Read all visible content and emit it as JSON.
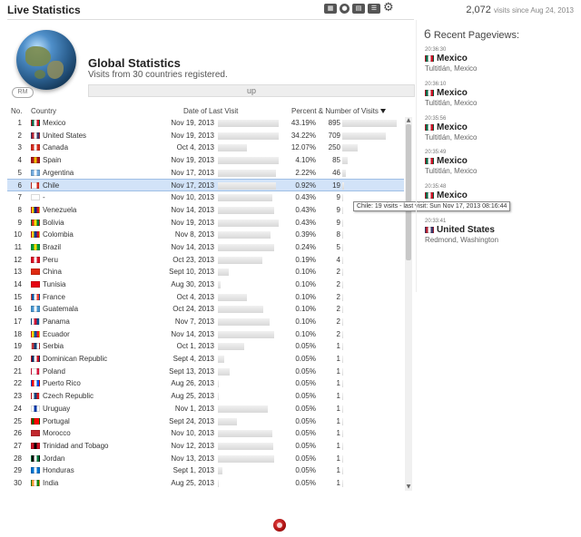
{
  "app": {
    "title": "Live Statistics"
  },
  "toolbar": {
    "icons": [
      "map-icon",
      "globe-icon",
      "stats-icon",
      "list-icon",
      "settings-icon"
    ]
  },
  "visits": {
    "count": "2,072",
    "since": "visits since Aug 24, 2013"
  },
  "global": {
    "heading": "Global Statistics",
    "subtitle": "Visits from 30 countries registered.",
    "up_label": "up",
    "rm_label": "RM"
  },
  "table": {
    "headers": {
      "no": "No.",
      "country": "Country",
      "date": "Date of Last Visit",
      "pct": "Percent & Number of Visits"
    },
    "selected_row": 6,
    "rows": [
      {
        "no": "1",
        "country": "Mexico",
        "date": "Nov 19, 2013",
        "date_fill": 0.95,
        "pct": "43.19%",
        "count": "895",
        "count_fill": 1.0,
        "flag": [
          "#006847",
          "#fff",
          "#ce1126"
        ]
      },
      {
        "no": "2",
        "country": "United States",
        "date": "Nov 19, 2013",
        "date_fill": 0.95,
        "pct": "34.22%",
        "count": "709",
        "count_fill": 0.8,
        "flag": [
          "#b22234",
          "#fff",
          "#3c3b6e"
        ]
      },
      {
        "no": "3",
        "country": "Canada",
        "date": "Oct 4, 2013",
        "date_fill": 0.45,
        "pct": "12.07%",
        "count": "250",
        "count_fill": 0.28,
        "flag": [
          "#d52b1e",
          "#fff",
          "#d52b1e"
        ]
      },
      {
        "no": "4",
        "country": "Spain",
        "date": "Nov 19, 2013",
        "date_fill": 0.95,
        "pct": "4.10%",
        "count": "85",
        "count_fill": 0.1,
        "flag": [
          "#aa151b",
          "#f1bf00",
          "#aa151b"
        ]
      },
      {
        "no": "5",
        "country": "Argentina",
        "date": "Nov 17, 2013",
        "date_fill": 0.92,
        "pct": "2.22%",
        "count": "46",
        "count_fill": 0.06,
        "flag": [
          "#74acdf",
          "#fff",
          "#74acdf"
        ]
      },
      {
        "no": "6",
        "country": "Chile",
        "date": "Nov 17, 2013",
        "date_fill": 0.92,
        "pct": "0.92%",
        "count": "19",
        "count_fill": 0.03,
        "flag": [
          "#fff",
          "#fff",
          "#d52b1e"
        ]
      },
      {
        "no": "7",
        "country": "-",
        "date": "Nov 10, 2013",
        "date_fill": 0.85,
        "pct": "0.43%",
        "count": "9",
        "count_fill": 0.01,
        "flag": [
          "#fff",
          "#fff",
          "#fff"
        ]
      },
      {
        "no": "8",
        "country": "Venezuela",
        "date": "Nov 14, 2013",
        "date_fill": 0.89,
        "pct": "0.43%",
        "count": "9",
        "count_fill": 0.01,
        "flag": [
          "#ffcc00",
          "#00247d",
          "#cf142b"
        ]
      },
      {
        "no": "9",
        "country": "Bolivia",
        "date": "Nov 19, 2013",
        "date_fill": 0.95,
        "pct": "0.43%",
        "count": "9",
        "count_fill": 0.01,
        "flag": [
          "#d52b1e",
          "#f9e300",
          "#007934"
        ]
      },
      {
        "no": "10",
        "country": "Colombia",
        "date": "Nov 8, 2013",
        "date_fill": 0.83,
        "pct": "0.39%",
        "count": "8",
        "count_fill": 0.01,
        "flag": [
          "#fcd116",
          "#003893",
          "#ce1126"
        ]
      },
      {
        "no": "11",
        "country": "Brazil",
        "date": "Nov 14, 2013",
        "date_fill": 0.89,
        "pct": "0.24%",
        "count": "5",
        "count_fill": 0.01,
        "flag": [
          "#009c3b",
          "#ffdf00",
          "#009c3b"
        ]
      },
      {
        "no": "12",
        "country": "Peru",
        "date": "Oct 23, 2013",
        "date_fill": 0.7,
        "pct": "0.19%",
        "count": "4",
        "count_fill": 0.01,
        "flag": [
          "#d91023",
          "#fff",
          "#d91023"
        ]
      },
      {
        "no": "13",
        "country": "China",
        "date": "Sept 10, 2013",
        "date_fill": 0.17,
        "pct": "0.10%",
        "count": "2",
        "count_fill": 0.005,
        "flag": [
          "#de2910",
          "#de2910",
          "#de2910"
        ]
      },
      {
        "no": "14",
        "country": "Tunisia",
        "date": "Aug 30, 2013",
        "date_fill": 0.04,
        "pct": "0.10%",
        "count": "2",
        "count_fill": 0.005,
        "flag": [
          "#e70013",
          "#e70013",
          "#e70013"
        ]
      },
      {
        "no": "15",
        "country": "France",
        "date": "Oct 4, 2013",
        "date_fill": 0.45,
        "pct": "0.10%",
        "count": "2",
        "count_fill": 0.005,
        "flag": [
          "#0055a4",
          "#fff",
          "#ef4135"
        ]
      },
      {
        "no": "16",
        "country": "Guatemala",
        "date": "Oct 24, 2013",
        "date_fill": 0.71,
        "pct": "0.10%",
        "count": "2",
        "count_fill": 0.005,
        "flag": [
          "#4997d0",
          "#fff",
          "#4997d0"
        ]
      },
      {
        "no": "17",
        "country": "Panama",
        "date": "Nov 7, 2013",
        "date_fill": 0.82,
        "pct": "0.10%",
        "count": "2",
        "count_fill": 0.005,
        "flag": [
          "#fff",
          "#d21034",
          "#005293"
        ]
      },
      {
        "no": "18",
        "country": "Ecuador",
        "date": "Nov 14, 2013",
        "date_fill": 0.89,
        "pct": "0.10%",
        "count": "2",
        "count_fill": 0.005,
        "flag": [
          "#ffdd00",
          "#034ea2",
          "#ed1c24"
        ]
      },
      {
        "no": "19",
        "country": "Serbia",
        "date": "Oct 1, 2013",
        "date_fill": 0.41,
        "pct": "0.05%",
        "count": "1",
        "count_fill": 0.003,
        "flag": [
          "#c6363c",
          "#0c4076",
          "#fff"
        ]
      },
      {
        "no": "20",
        "country": "Dominican Republic",
        "date": "Sept 4, 2013",
        "date_fill": 0.1,
        "pct": "0.05%",
        "count": "1",
        "count_fill": 0.003,
        "flag": [
          "#002d62",
          "#fff",
          "#ce1126"
        ]
      },
      {
        "no": "21",
        "country": "Poland",
        "date": "Sept 13, 2013",
        "date_fill": 0.19,
        "pct": "0.05%",
        "count": "1",
        "count_fill": 0.003,
        "flag": [
          "#fff",
          "#fff",
          "#dc143c"
        ]
      },
      {
        "no": "22",
        "country": "Puerto Rico",
        "date": "Aug 26, 2013",
        "date_fill": 0.01,
        "pct": "0.05%",
        "count": "1",
        "count_fill": 0.003,
        "flag": [
          "#ed0000",
          "#fff",
          "#0050f0"
        ]
      },
      {
        "no": "23",
        "country": "Czech Republic",
        "date": "Aug 25, 2013",
        "date_fill": 0.01,
        "pct": "0.05%",
        "count": "1",
        "count_fill": 0.003,
        "flag": [
          "#fff",
          "#11457e",
          "#d7141a"
        ]
      },
      {
        "no": "24",
        "country": "Uruguay",
        "date": "Nov 1, 2013",
        "date_fill": 0.78,
        "pct": "0.05%",
        "count": "1",
        "count_fill": 0.003,
        "flag": [
          "#fff",
          "#0038a8",
          "#fff"
        ]
      },
      {
        "no": "25",
        "country": "Portugal",
        "date": "Sept 24, 2013",
        "date_fill": 0.3,
        "pct": "0.05%",
        "count": "1",
        "count_fill": 0.003,
        "flag": [
          "#006600",
          "#ff0000",
          "#ff0000"
        ]
      },
      {
        "no": "26",
        "country": "Morocco",
        "date": "Nov 10, 2013",
        "date_fill": 0.85,
        "pct": "0.05%",
        "count": "1",
        "count_fill": 0.003,
        "flag": [
          "#c1272d",
          "#c1272d",
          "#c1272d"
        ]
      },
      {
        "no": "27",
        "country": "Trinidad and Tobago",
        "date": "Nov 12, 2013",
        "date_fill": 0.87,
        "pct": "0.05%",
        "count": "1",
        "count_fill": 0.003,
        "flag": [
          "#ce1126",
          "#000",
          "#ce1126"
        ]
      },
      {
        "no": "28",
        "country": "Jordan",
        "date": "Nov 13, 2013",
        "date_fill": 0.88,
        "pct": "0.05%",
        "count": "1",
        "count_fill": 0.003,
        "flag": [
          "#000",
          "#fff",
          "#007a3d"
        ]
      },
      {
        "no": "29",
        "country": "Honduras",
        "date": "Sept 1, 2013",
        "date_fill": 0.07,
        "pct": "0.05%",
        "count": "1",
        "count_fill": 0.003,
        "flag": [
          "#0073cf",
          "#fff",
          "#0073cf"
        ]
      },
      {
        "no": "30",
        "country": "India",
        "date": "Aug 25, 2013",
        "date_fill": 0.01,
        "pct": "0.05%",
        "count": "1",
        "count_fill": 0.003,
        "flag": [
          "#ff9933",
          "#fff",
          "#138808"
        ]
      }
    ]
  },
  "tooltip": {
    "text": "Chile: 19 visits - last visit: Sun Nov 17, 2013 08:16:44"
  },
  "recent": {
    "count": "6",
    "label": "Recent Pageviews:",
    "items": [
      {
        "time": "20:36:30",
        "country": "Mexico",
        "city": "Tultitlán, Mexico",
        "flag": [
          "#006847",
          "#fff",
          "#ce1126"
        ]
      },
      {
        "time": "20:36:10",
        "country": "Mexico",
        "city": "Tultitlán, Mexico",
        "flag": [
          "#006847",
          "#fff",
          "#ce1126"
        ]
      },
      {
        "time": "20:35:56",
        "country": "Mexico",
        "city": "Tultitlán, Mexico",
        "flag": [
          "#006847",
          "#fff",
          "#ce1126"
        ]
      },
      {
        "time": "20:35:49",
        "country": "Mexico",
        "city": "Tultitlán, Mexico",
        "flag": [
          "#006847",
          "#fff",
          "#ce1126"
        ]
      },
      {
        "time": "20:35:48",
        "country": "Mexico",
        "city": "",
        "flag": [
          "#006847",
          "#fff",
          "#ce1126"
        ]
      },
      {
        "time": "20:33:41",
        "country": "United States",
        "city": "Redmond, Washington",
        "flag": [
          "#b22234",
          "#fff",
          "#3c3b6e"
        ]
      }
    ]
  }
}
